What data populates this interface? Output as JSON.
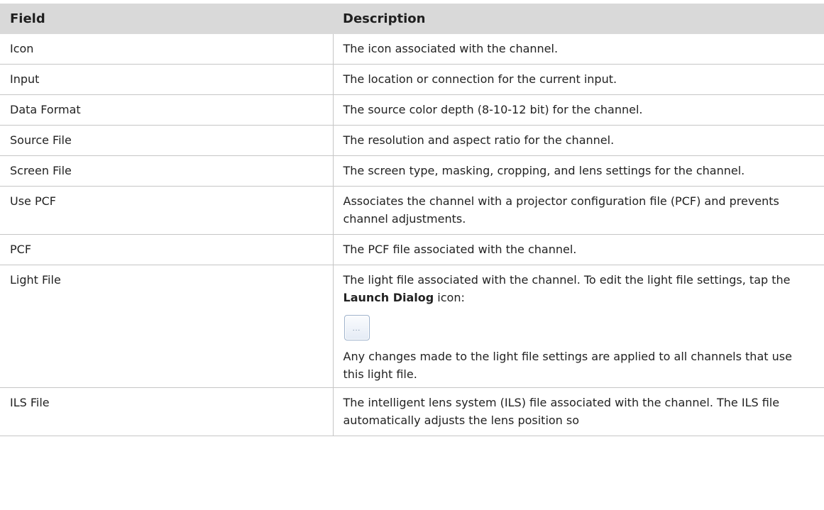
{
  "table": {
    "headers": {
      "field": "Field",
      "description": "Description"
    },
    "rows": [
      {
        "field": "Icon",
        "description": "The icon associated with the channel."
      },
      {
        "field": "Input",
        "description": "The location or connection for the current input."
      },
      {
        "field": "Data Format",
        "description": "The source color depth (8-10-12 bit) for the channel."
      },
      {
        "field": "Source File",
        "description": "The resolution and aspect ratio for the channel."
      },
      {
        "field": "Screen File",
        "description": "The screen type, masking, cropping, and lens settings for the channel."
      },
      {
        "field": "Use PCF",
        "description": "Associates the channel with a projector configuration file (PCF) and prevents channel adjustments."
      },
      {
        "field": "PCF",
        "description": "The PCF file associated with the channel."
      },
      {
        "field": "Light File",
        "description_pre": "The light file associated with the channel. To edit the light file settings, tap the ",
        "description_bold": "Launch Dialog",
        "description_post": " icon:",
        "icon": "launch-dialog-icon",
        "icon_glyph": "...",
        "note": "Any changes made to the light file settings are applied to all channels that use this light file."
      },
      {
        "field": "ILS File",
        "description": "The intelligent lens system (ILS) file associated with the channel. The ILS file automatically adjusts the lens position so"
      }
    ]
  }
}
